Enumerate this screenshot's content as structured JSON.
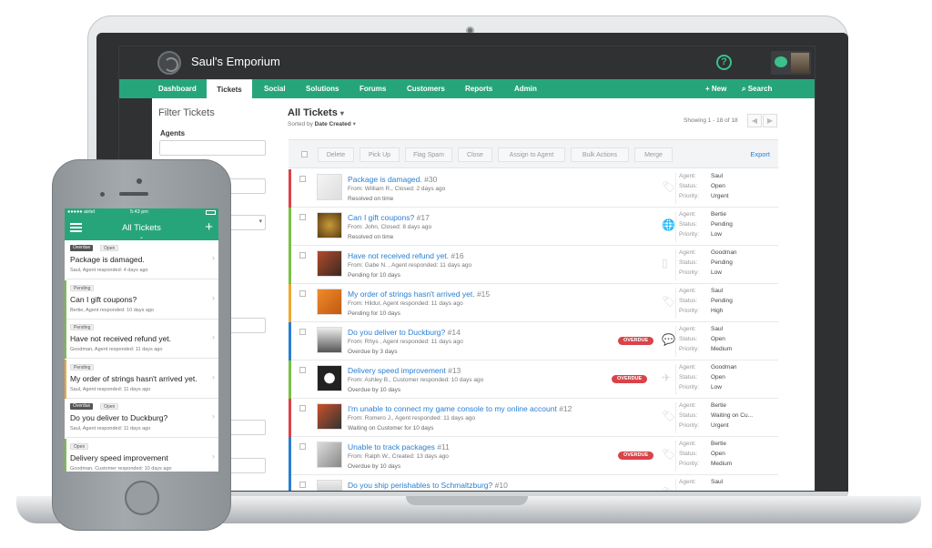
{
  "app": {
    "name": "Saul's Emporium"
  },
  "nav": {
    "items": [
      "Dashboard",
      "Tickets",
      "Social",
      "Solutions",
      "Forums",
      "Customers",
      "Reports",
      "Admin"
    ],
    "active": "Tickets",
    "new_label": "+ New",
    "search_label": "Search"
  },
  "filter": {
    "title": "Filter Tickets",
    "agents_label": "Agents"
  },
  "list": {
    "title": "All Tickets",
    "sort_prefix": "Sorted by",
    "sort_value": "Date Created",
    "showing": "Showing 1 - 18 of 18",
    "toolbar": [
      "Delete",
      "Pick Up",
      "Flag Spam",
      "Close",
      "Assign to Agent",
      "Bulk Actions",
      "Merge"
    ],
    "export_label": "Export",
    "meta_keys": {
      "agent": "Agent:",
      "status": "Status:",
      "priority": "Priority:"
    },
    "overdue_label": "OVERDUE"
  },
  "tickets": [
    {
      "subject": "Package is damaged.",
      "num": "#30",
      "from": "From: William R., Closed: 2 days ago",
      "state": "Resolved on time",
      "agent": "Saul",
      "status": "Open",
      "priority": "Urgent",
      "stripe": "#d9434a",
      "overdue": false
    },
    {
      "subject": "Can I gift coupons?",
      "num": "#17",
      "from": "From: John, Closed: 8 days ago",
      "state": "Resolved on time",
      "agent": "Bertie",
      "status": "Pending",
      "priority": "Low",
      "stripe": "#7bc043",
      "overdue": false
    },
    {
      "subject": "Have not received refund yet.",
      "num": "#16",
      "from": "From: Gabe N. , Agent responded: 11 days ago",
      "state": "Pending for 10 days",
      "agent": "Goodman",
      "status": "Pending",
      "priority": "Low",
      "stripe": "#7bc043",
      "overdue": false
    },
    {
      "subject": "My order of strings hasn't arrived yet.",
      "num": "#15",
      "from": "From: Hildur, Agent responded: 11 days ago",
      "state": "Pending for 10 days",
      "agent": "Saul",
      "status": "Pending",
      "priority": "High",
      "stripe": "#f0a830",
      "overdue": false
    },
    {
      "subject": "Do you deliver to Duckburg?",
      "num": "#14",
      "from": "From: Rhys , Agent responded: 11 days ago",
      "state": "Overdue by 3 days",
      "agent": "Saul",
      "status": "Open",
      "priority": "Medium",
      "stripe": "#2a7fd1",
      "overdue": true
    },
    {
      "subject": "Delivery speed improvement",
      "num": "#13",
      "from": "From: Ashley B., Customer responded: 10 days ago",
      "state": "Overdue by 10 days",
      "agent": "Goodman",
      "status": "Open",
      "priority": "Low",
      "stripe": "#7bc043",
      "overdue": true
    },
    {
      "subject": "I'm unable to connect my game console to my online account",
      "num": "#12",
      "from": "From: Romero J., Agent responded: 11 days ago",
      "state": "Waiting on Customer for 10 days",
      "agent": "Bertie",
      "status": "Waiting on Cu...",
      "priority": "Urgent",
      "stripe": "#d9434a",
      "overdue": false
    },
    {
      "subject": "Unable to track packages",
      "num": "#11",
      "from": "From: Ralph W., Created: 13 days ago",
      "state": "Overdue by 10 days",
      "agent": "Bertie",
      "status": "Open",
      "priority": "Medium",
      "stripe": "#2a7fd1",
      "overdue": true
    },
    {
      "subject": "Do you ship perishables to Schmaltzburg?",
      "num": "#10",
      "from": "",
      "state": "",
      "agent": "Saul",
      "status": "",
      "priority": "",
      "stripe": "#2a7fd1",
      "overdue": false
    }
  ],
  "phone": {
    "carrier": "●●●●● airtel",
    "time": "5:43 pm",
    "title": "All Tickets",
    "items": [
      {
        "tags": [
          "Overdue",
          "Open"
        ],
        "subject": "Package is damaged.",
        "meta": "Saul, Agent responded: 4 days ago",
        "stripe": "#ffffff"
      },
      {
        "tags": [
          "Pending"
        ],
        "subject": "Can I gift coupons?",
        "meta": "Bertie, Agent responded: 10 days ago",
        "stripe": "#7bc043"
      },
      {
        "tags": [
          "Pending"
        ],
        "subject": "Have not received refund yet.",
        "meta": "Goodman, Agent responded: 11 days ago",
        "stripe": "#7bc043"
      },
      {
        "tags": [
          "Pending"
        ],
        "subject": "My order of strings hasn't arrived yet.",
        "meta": "Saul, Agent responded: 11 days ago",
        "stripe": "#f0a830"
      },
      {
        "tags": [
          "Overdue",
          "Open"
        ],
        "subject": "Do you deliver to Duckburg?",
        "meta": "Saul, Agent responded: 11 days ago",
        "stripe": "#ffffff"
      },
      {
        "tags": [
          "Open"
        ],
        "subject": "Delivery speed improvement",
        "meta": "Goodman, Customer responded: 10 days ago",
        "stripe": "#7bc043"
      }
    ]
  }
}
